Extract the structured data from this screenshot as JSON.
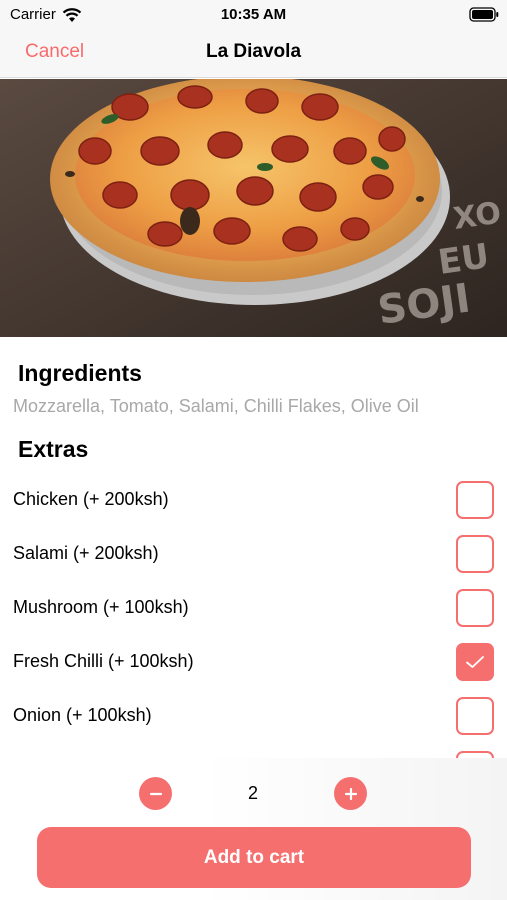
{
  "status_bar": {
    "carrier": "Carrier",
    "time": "10:35 AM",
    "wifi_icon": "wifi-icon",
    "battery_icon": "battery-icon"
  },
  "nav": {
    "cancel_label": "Cancel",
    "title": "La Diavola"
  },
  "hero": {
    "image": "pepperoni-pizza-photo"
  },
  "ingredients": {
    "title": "Ingredients",
    "text": "Mozzarella, Tomato, Salami, Chilli Flakes, Olive Oil"
  },
  "extras": {
    "title": "Extras",
    "items": [
      {
        "label": "Chicken (+ 200ksh)",
        "checked": false
      },
      {
        "label": "Salami (+ 200ksh)",
        "checked": false
      },
      {
        "label": "Mushroom (+ 100ksh)",
        "checked": false
      },
      {
        "label": "Fresh Chilli (+ 100ksh)",
        "checked": true
      },
      {
        "label": "Onion (+ 100ksh)",
        "checked": false
      },
      {
        "label": "",
        "checked": false
      }
    ]
  },
  "quantity": {
    "value": "2",
    "minus_icon": "minus-icon",
    "plus_icon": "plus-icon"
  },
  "cart": {
    "button_label": "Add to cart"
  },
  "colors": {
    "accent": "#f56f6f",
    "muted_text": "#a8a8a8",
    "nav_background": "#f7f7f7"
  }
}
